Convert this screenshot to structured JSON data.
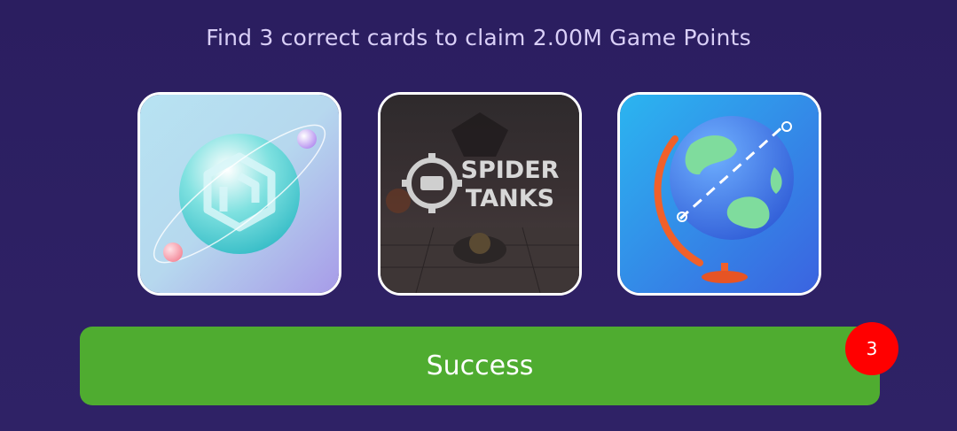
{
  "header": {
    "instruction": "Find 3 correct cards to claim 2.00M Game Points"
  },
  "cards": [
    {
      "name": "Orbit sphere logo",
      "icon": "planet-logo-icon"
    },
    {
      "name": "Spider Tanks",
      "title_line1": "SPIDER",
      "title_line2": "TANKS",
      "icon": "spider-tanks-logo"
    },
    {
      "name": "Globe",
      "icon": "globe-icon"
    }
  ],
  "action": {
    "button_label": "Success",
    "badge_count": "3"
  },
  "colors": {
    "background": "#2c1f62",
    "instruction_text": "#d9cff7",
    "button": "#4fac30",
    "badge": "#ff0000",
    "card_border": "#ffffff"
  }
}
